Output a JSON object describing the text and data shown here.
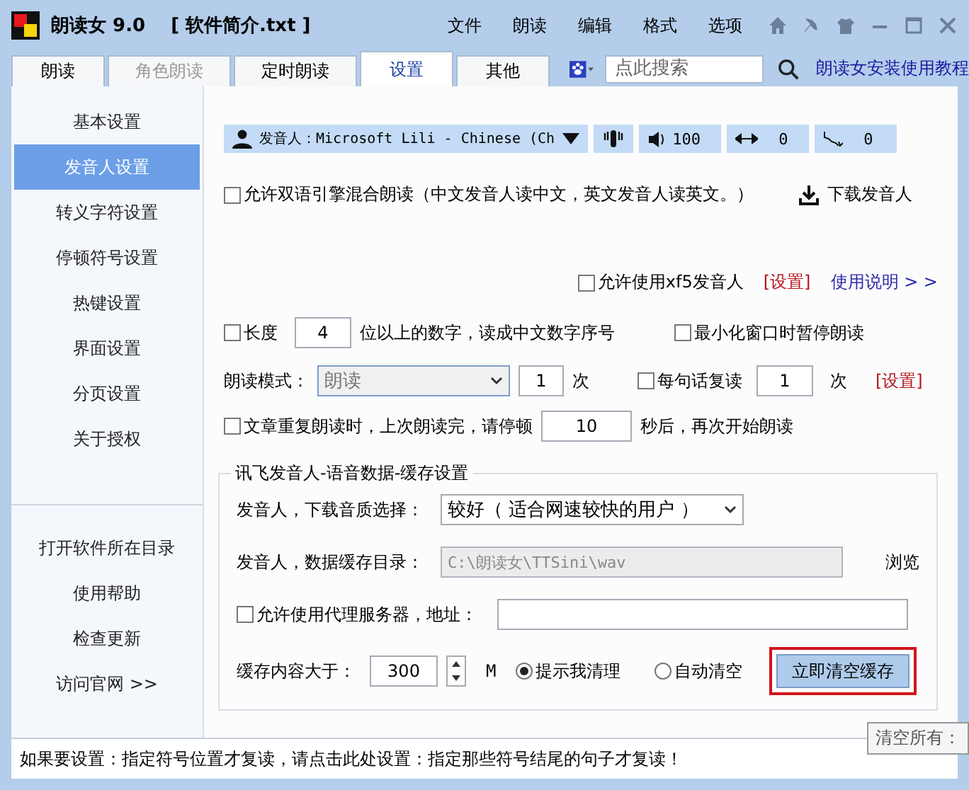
{
  "window": {
    "app_name": "朗读女 9.0",
    "document": "[ 软件简介.txt ]"
  },
  "menu": [
    "文件",
    "朗读",
    "编辑",
    "格式",
    "选项"
  ],
  "tabs": [
    {
      "label": "朗读",
      "selected": false,
      "disabled": false
    },
    {
      "label": "角色朗读",
      "selected": false,
      "disabled": true
    },
    {
      "label": "定时朗读",
      "selected": false,
      "disabled": false
    },
    {
      "label": "设置",
      "selected": true,
      "disabled": false
    },
    {
      "label": "其他",
      "selected": false,
      "disabled": false
    }
  ],
  "search": {
    "placeholder": "点此搜索"
  },
  "tutorial_link": "朗读女安装使用教程",
  "sidebar": {
    "items": [
      {
        "label": "基本设置",
        "selected": false
      },
      {
        "label": "发音人设置",
        "selected": true
      },
      {
        "label": "转义字符设置",
        "selected": false
      },
      {
        "label": "停顿符号设置",
        "selected": false
      },
      {
        "label": "热键设置",
        "selected": false
      },
      {
        "label": "界面设置",
        "selected": false
      },
      {
        "label": "分页设置",
        "selected": false
      },
      {
        "label": "关于授权",
        "selected": false
      }
    ],
    "links": [
      "打开软件所在目录",
      "使用帮助",
      "检查更新",
      "访问官网 >>"
    ]
  },
  "voice_bar": {
    "speaker": "发音人：Microsoft Lili - Chinese (Ch",
    "volume": "100",
    "speed": "0",
    "pitch": "0"
  },
  "mix_engine": {
    "label": "允许双语引擎混合朗读（中文发音人读中文，英文发音人读英文。）",
    "checked": false
  },
  "download_voice": "下载发音人",
  "xf5": {
    "label": "允许使用xf5发音人",
    "checked": false,
    "settings": "[设置]",
    "help": "使用说明 > >"
  },
  "digits": {
    "label_before": "长度",
    "value": "4",
    "label_after": "位以上的数字，读成中文数字序号",
    "checked": false
  },
  "pause_minimized": {
    "label": "最小化窗口时暂停朗读",
    "checked": false
  },
  "mode": {
    "label": "朗读模式：",
    "value": "朗读",
    "count": "1",
    "unit": "次"
  },
  "sentence_repeat": {
    "label": "每句话复读",
    "checked": false,
    "count": "1",
    "unit": "次",
    "settings": "[设置]"
  },
  "article_repeat": {
    "label_before": "文章重复朗读时，上次朗读完，请停顿",
    "value": "10",
    "label_after": "秒后，再次开始朗读",
    "checked": false
  },
  "cache": {
    "title": "讯飞发音人-语音数据-缓存设置",
    "quality_label": "发音人，下载音质选择：",
    "quality": "较好（ 适合网速较快的用户 ）",
    "dir_label": "发音人，数据缓存目录：",
    "dir": "C:\\朗读女\\TTSini\\wav",
    "browse": "浏览",
    "proxy": {
      "label": "允许使用代理服务器，地址：",
      "checked": false
    },
    "limit_label": "缓存内容大于：",
    "limit": "300",
    "unit": "M",
    "options": [
      {
        "label": "提示我清理",
        "selected": true
      },
      {
        "label": "自动清空",
        "selected": false
      }
    ],
    "clear_button": "立即清空缓存"
  },
  "tooltip": "清空所有：",
  "status_bar": "如果要设置：指定符号位置才复读，请点击此处设置：指定那些符号结尾的句子才复读！"
}
